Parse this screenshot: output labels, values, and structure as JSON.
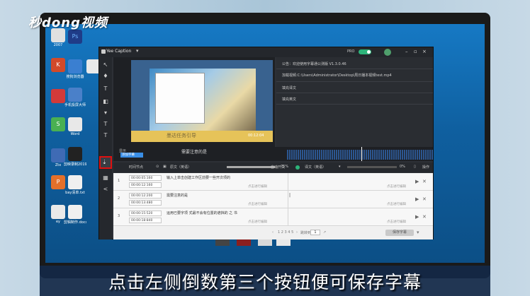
{
  "watermark": {
    "logo_text": "秒dong视频"
  },
  "desktop": {
    "icons": [
      {
        "label": "2007",
        "color": "#e0e0e0"
      },
      {
        "label": "Ps",
        "color": "#1f3c88"
      },
      {
        "label": "K",
        "color": "#d24a2a"
      },
      {
        "label": "搜狗浏览器",
        "color": "#3a7fd1"
      },
      {
        "label": "",
        "color": "#e9e9e9"
      },
      {
        "label": "",
        "color": "#d23a3a"
      },
      {
        "label": "手机投屏大师",
        "color": "#4a80c9"
      },
      {
        "label": "S",
        "color": "#4ab052"
      },
      {
        "label": "Word",
        "color": "#e8e8e8"
      },
      {
        "label": "Ztx",
        "color": "#3f6bb5"
      },
      {
        "label": "剪映录制2019",
        "color": "#222"
      },
      {
        "label": "P",
        "color": "#e4702a"
      },
      {
        "label": "bay清单.txt",
        "color": "#f0f0f0"
      },
      {
        "label": "ey",
        "color": "#e9e9e9"
      },
      {
        "label": "剪辑制作.docx",
        "color": "#f0f0f0"
      }
    ]
  },
  "app": {
    "title": "Yee Caption",
    "pro_label": "PRO",
    "window_controls": {
      "minimize": "–",
      "maximize": "▫",
      "close": "×"
    },
    "toolbar": {
      "tools": [
        {
          "name": "cursor-icon",
          "glyph": "↖"
        },
        {
          "name": "mic-icon",
          "glyph": "♦"
        },
        {
          "name": "text-icon",
          "glyph": "T"
        },
        {
          "name": "import-icon",
          "glyph": "◧"
        },
        {
          "name": "download-icon",
          "glyph": "▾"
        },
        {
          "name": "font-icon",
          "glyph": "T"
        },
        {
          "name": "text2-icon",
          "glyph": "T"
        },
        {
          "name": "save-icon",
          "glyph": "⇣"
        },
        {
          "name": "grid-icon",
          "glyph": "▦"
        },
        {
          "name": "share-icon",
          "glyph": "<"
        }
      ]
    },
    "preview": {
      "subtitle_text": "墨达任务引导",
      "time_display": "00:12:04"
    },
    "info": {
      "notice": "公告：欢迎使用字幕通公测版 V1.3.0.46",
      "path": "加载视频:C:\\Users\\Administrator\\Desktop\\周日播本视频test.mp4",
      "fill_original": "填充译文",
      "fill_translation": "填充英文"
    },
    "timeline": {
      "caption_label": "显示",
      "caption_box": "添加字幕",
      "center_label": "需要注意的是"
    },
    "grid_header": {
      "start_time": "时间节点",
      "original": "原文（英语）",
      "percent1": "75%",
      "auto_translate": "自动开关",
      "translation": "译文（英语）",
      "percent2": "0%",
      "action": "操作"
    },
    "rows": [
      {
        "index": "1",
        "start": "00:00:05:160",
        "end": "00:00:12:160",
        "text": "输入上单击创建工作区前要一些开次项的",
        "hint1": "点击进行编辑",
        "hint2": "点击进行编辑"
      },
      {
        "index": "2",
        "start": "00:00:12:200",
        "end": "00:00:13:480",
        "text": "需要注意的是",
        "hint1": "点击进行编辑",
        "hint2": "点击进行编辑"
      },
      {
        "index": "3",
        "start": "00:00:15:520",
        "end": "00:00:18:840",
        "text": "运用已要字项 式最不会有位置的遮挡的 之 书",
        "hint1": "点击进行编辑",
        "hint2": "点击进行编辑"
      }
    ],
    "pager": {
      "prev": "‹",
      "pages": "1  2  3  4  5",
      "next": "›",
      "goto": "跳转到",
      "page_value": "1",
      "save_button": "保存字幕"
    }
  },
  "subtitle": "点击左侧倒数第三个按钮便可保存字幕"
}
